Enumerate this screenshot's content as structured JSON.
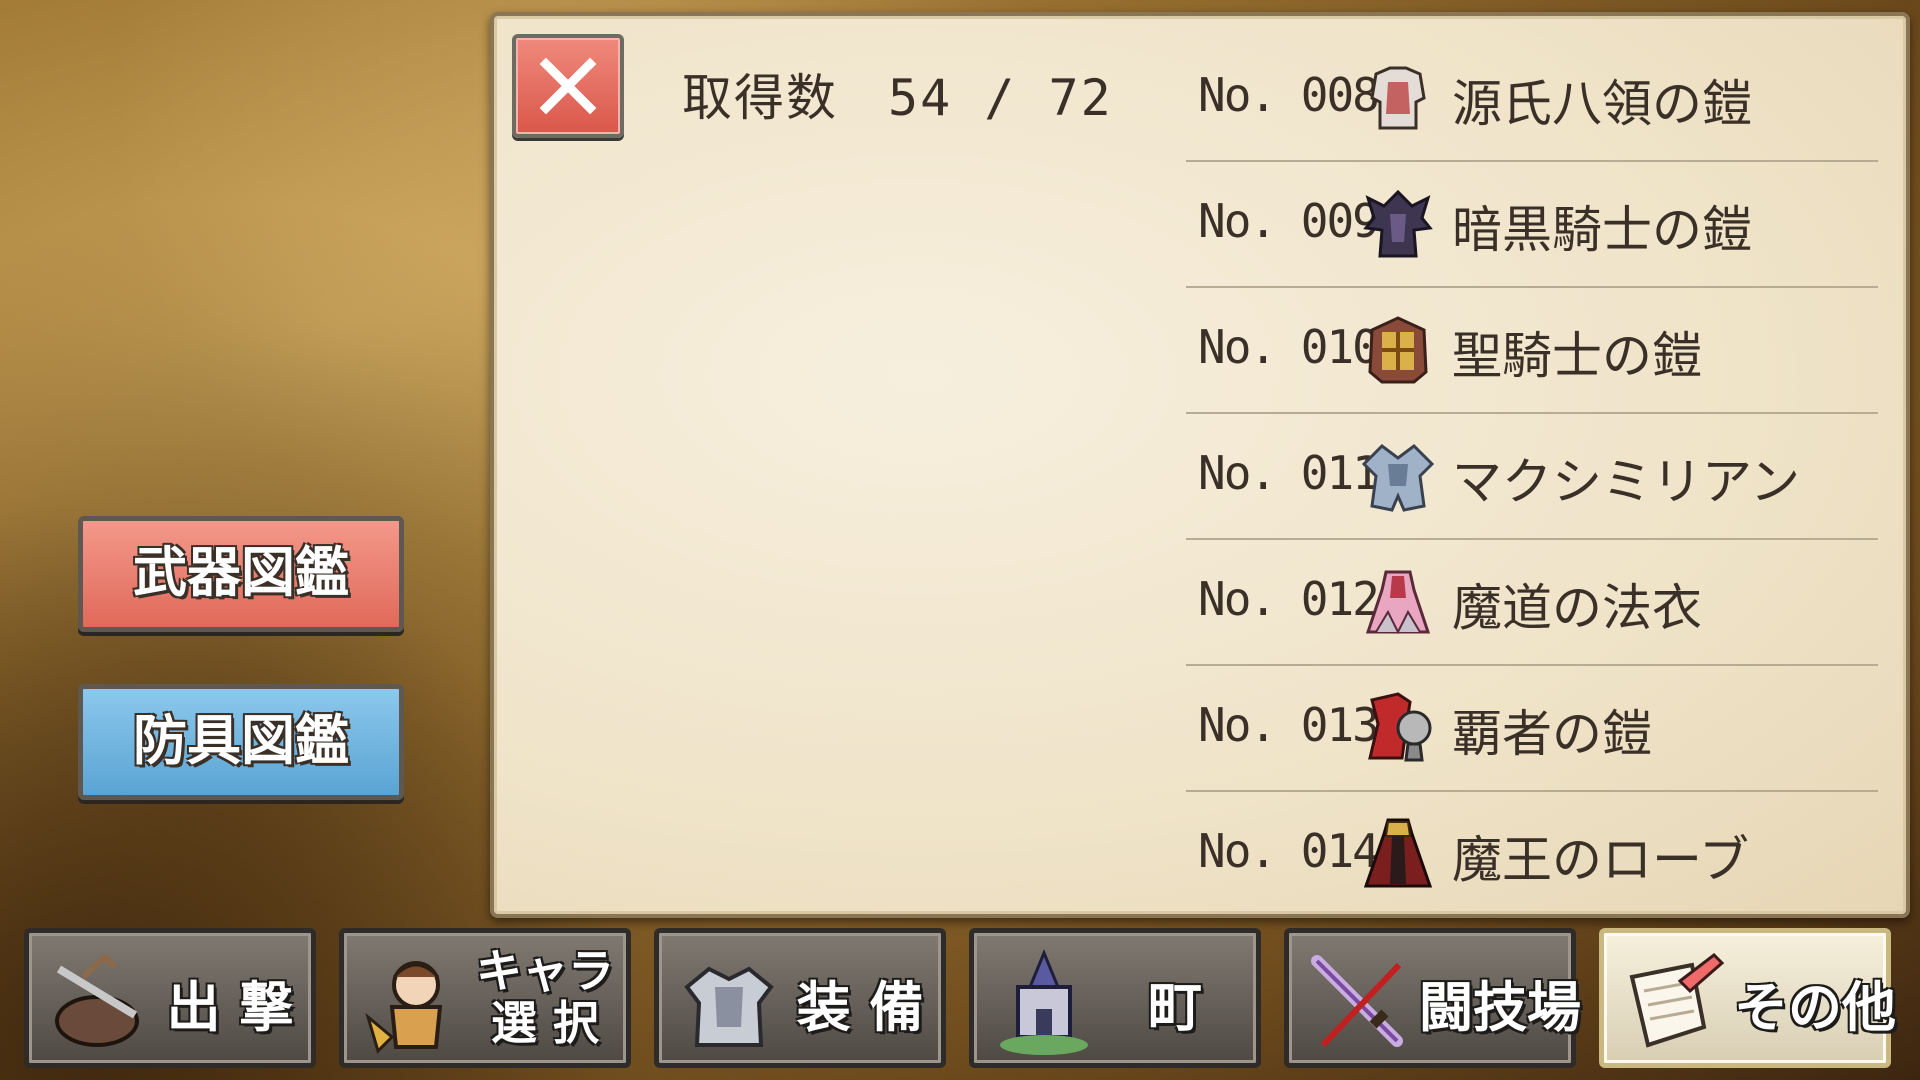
{
  "collection": {
    "count_label": "取得数",
    "count_value": "54 / 72"
  },
  "armor_list": [
    {
      "no": "No. 008",
      "name": "源氏八領の鎧",
      "icon": "white-armor-icon",
      "color": "#c9b8b0"
    },
    {
      "no": "No. 009",
      "name": "暗黒騎士の鎧",
      "icon": "dark-armor-icon",
      "color": "#3e3550"
    },
    {
      "no": "No. 010",
      "name": "聖騎士の鎧",
      "icon": "holy-armor-icon",
      "color": "#a05a3a"
    },
    {
      "no": "No. 011",
      "name": "マクシミリアン",
      "icon": "silver-armor-icon",
      "color": "#8fa2b8"
    },
    {
      "no": "No. 012",
      "name": "魔道の法衣",
      "icon": "robe-icon",
      "color": "#c47a9a"
    },
    {
      "no": "No. 013",
      "name": "覇者の鎧",
      "icon": "red-armor-icon",
      "color": "#b02a2a"
    },
    {
      "no": "No. 014",
      "name": "魔王のローブ",
      "icon": "demon-robe-icon",
      "color": "#7a1e1e"
    }
  ],
  "side_buttons": {
    "weapons": "武器図鑑",
    "armor": "防具図鑑"
  },
  "nav": [
    {
      "label": "出 撃",
      "icon": "sortie-icon"
    },
    {
      "label1": "キャラ",
      "label2": "選 択",
      "icon": "character-icon"
    },
    {
      "label": "装 備",
      "icon": "equipment-icon"
    },
    {
      "label": "町",
      "icon": "town-icon"
    },
    {
      "label": "闘技場",
      "icon": "arena-icon"
    },
    {
      "label": "その他",
      "icon": "scroll-icon",
      "active": true
    }
  ],
  "colors": {
    "weapons_button": "#e06a5a",
    "armor_button": "#5aa4d4",
    "close_button": "#d9574a"
  }
}
